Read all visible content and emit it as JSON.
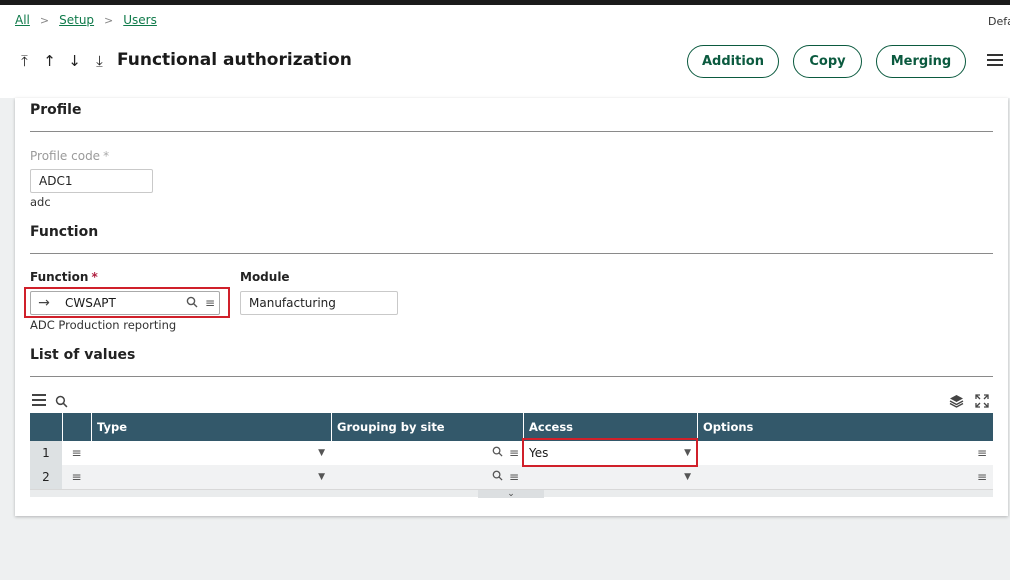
{
  "breadcrumb": {
    "items": [
      "All",
      "Setup",
      "Users"
    ],
    "separator": ">"
  },
  "header": {
    "default_label": "Defa",
    "title": "Functional authorization",
    "nav": {
      "first": "⤒",
      "prev": "↑",
      "next": "↓",
      "last": "⤓"
    },
    "buttons": {
      "addition": "Addition",
      "copy": "Copy",
      "merging": "Merging"
    }
  },
  "profile": {
    "section_title": "Profile",
    "code_label": "Profile code",
    "required_mark": "*",
    "code_value": "ADC1",
    "code_description": "adc"
  },
  "function": {
    "section_title": "Function",
    "function_label": "Function",
    "required_mark": "*",
    "function_value": "CWSAPT",
    "function_description": "ADC Production reporting",
    "module_label": "Module",
    "module_value": "Manufacturing"
  },
  "list": {
    "section_title": "List of values",
    "columns": [
      "Type",
      "Grouping by site",
      "Access",
      "Options"
    ],
    "rows": [
      {
        "num": "1",
        "type": "",
        "grouping": "",
        "access": "Yes",
        "options": ""
      },
      {
        "num": "2",
        "type": "",
        "grouping": "",
        "access": "",
        "options": ""
      }
    ]
  },
  "icons": {
    "menu": "hamburger-icon",
    "search": "search-icon",
    "layers": "layers-icon",
    "expand": "expand-icon",
    "arrow": "arrow-right-icon",
    "dropdown": "triangle-down-icon"
  },
  "colors": {
    "accent_green": "#0b5a3f",
    "link_green": "#0f7a4a",
    "grid_header": "#33586a",
    "highlight_red": "#d0202a"
  }
}
